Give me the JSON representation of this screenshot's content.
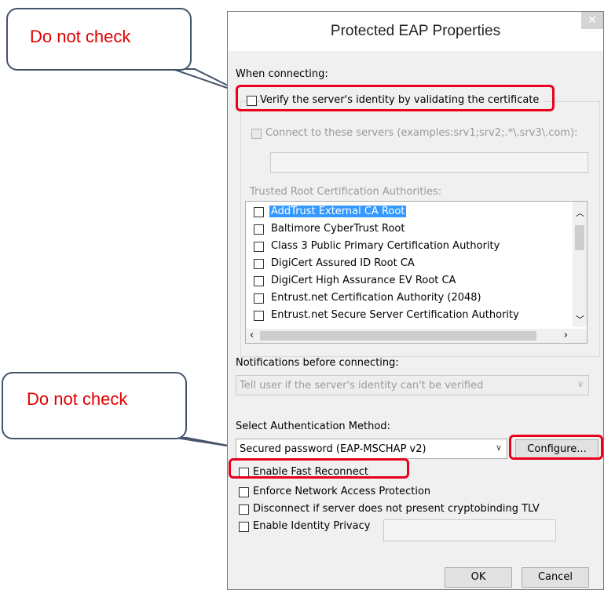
{
  "callouts": [
    {
      "text": "Do not check"
    },
    {
      "text": "Do not check"
    }
  ],
  "dialog": {
    "title": "Protected EAP Properties",
    "close_glyph": "✕",
    "section_connecting": "When connecting:",
    "verify_identity_label": "Verify the server's identity by validating the certificate",
    "connect_servers_label": "Connect to these servers (examples:srv1;srv2;.*\\.srv3\\.com):",
    "connect_servers_value": "",
    "trusted_root_label": "Trusted Root Certification Authorities:",
    "cert_list": [
      {
        "label": "AddTrust External CA Root",
        "selected": true
      },
      {
        "label": "Baltimore CyberTrust Root",
        "selected": false
      },
      {
        "label": "Class 3 Public Primary Certification Authority",
        "selected": false
      },
      {
        "label": "DigiCert Assured ID Root CA",
        "selected": false
      },
      {
        "label": "DigiCert High Assurance EV Root CA",
        "selected": false
      },
      {
        "label": "Entrust.net Certification Authority (2048)",
        "selected": false
      },
      {
        "label": "Entrust.net Secure Server Certification Authority",
        "selected": false
      }
    ],
    "notifications_label": "Notifications before connecting:",
    "notifications_value": "Tell user if the server's identity can't be verified",
    "auth_method_label": "Select Authentication Method:",
    "auth_method_value": "Secured password (EAP-MSCHAP v2)",
    "configure_label": "Configure...",
    "options": [
      {
        "label": "Enable Fast Reconnect"
      },
      {
        "label": "Enforce Network Access Protection"
      },
      {
        "label": "Disconnect if server does not present cryptobinding TLV"
      },
      {
        "label": "Enable Identity Privacy"
      }
    ],
    "identity_privacy_value": "",
    "ok_label": "OK",
    "cancel_label": "Cancel"
  },
  "colors": {
    "highlight_red": "#e8001c",
    "callout_border": "#44546a",
    "callout_text": "#e00000",
    "selection_blue": "#3399ff"
  }
}
